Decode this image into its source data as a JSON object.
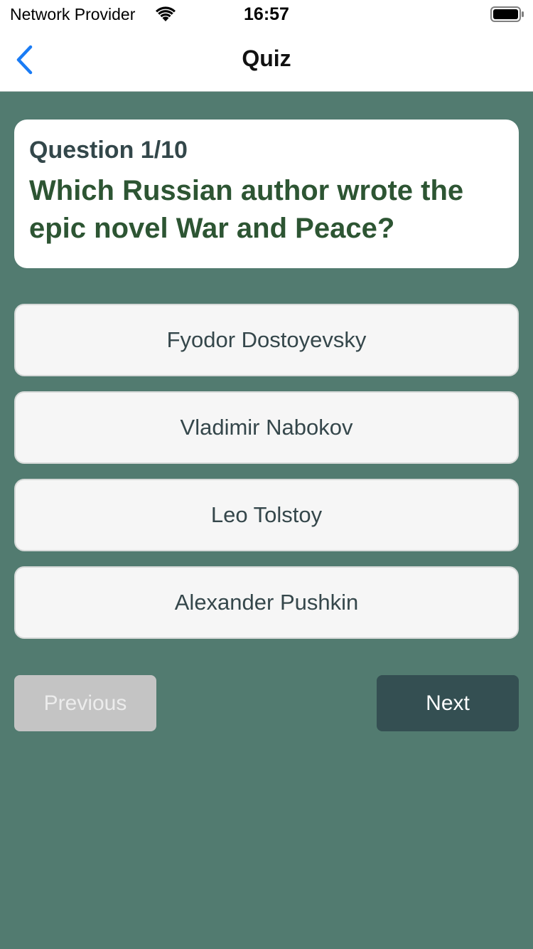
{
  "status_bar": {
    "carrier": "Network Provider",
    "time": "16:57",
    "wifi_icon": "wifi-icon",
    "battery_icon": "battery-full-icon"
  },
  "nav": {
    "title": "Quiz",
    "back_icon": "chevron-left-icon"
  },
  "question": {
    "counter": "Question 1/10",
    "text": "Which Russian author wrote the epic novel War and Peace?"
  },
  "answers": [
    "Fyodor Dostoyevsky",
    "Vladimir Nabokov",
    "Leo Tolstoy",
    "Alexander Pushkin"
  ],
  "controls": {
    "previous_label": "Previous",
    "previous_enabled": false,
    "next_label": "Next"
  },
  "colors": {
    "background": "#527b70",
    "question_text": "#2d5533",
    "next_button": "#344f52",
    "previous_disabled": "#c4c4c4",
    "accent_blue": "#1a7cf5"
  }
}
